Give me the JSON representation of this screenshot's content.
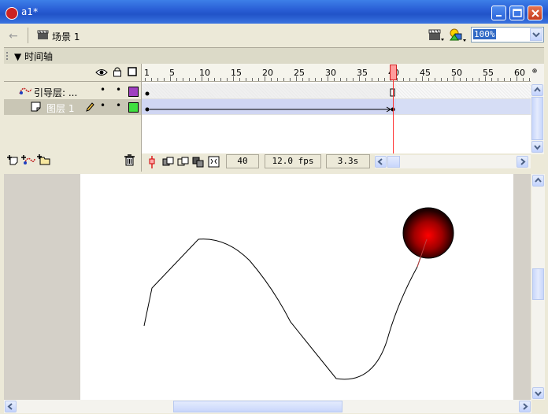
{
  "window": {
    "title": "a1*"
  },
  "scene_bar": {
    "back_label": "🡐",
    "scene_label": "场景 1",
    "zoom": "100%"
  },
  "timeline": {
    "header_label": "时间轴",
    "layers": [
      {
        "name": "引导层: ...",
        "type": "guide",
        "color": "#a040c0"
      },
      {
        "name": "图层 1",
        "type": "normal",
        "color": "#40e040",
        "selected": true
      }
    ],
    "ruler_numbers": [
      "1",
      "5",
      "10",
      "15",
      "20",
      "25",
      "30",
      "35",
      "40",
      "45",
      "50",
      "55",
      "60"
    ],
    "playhead_frame": "40",
    "current_frame": "40",
    "fps": "12.0 fps",
    "elapsed": "3.3s"
  },
  "colors": {
    "title_bar": "#2a5fd6",
    "panel": "#ece9d8",
    "playhead": "#ff3333",
    "ball_center": "#ff0000",
    "ball_edge": "#200000"
  },
  "icons": [
    "scene-icon",
    "edit-scene-icon",
    "edit-symbol-icon",
    "eye-icon",
    "lock-icon",
    "outline-icon",
    "pencil-icon",
    "trash-icon"
  ]
}
